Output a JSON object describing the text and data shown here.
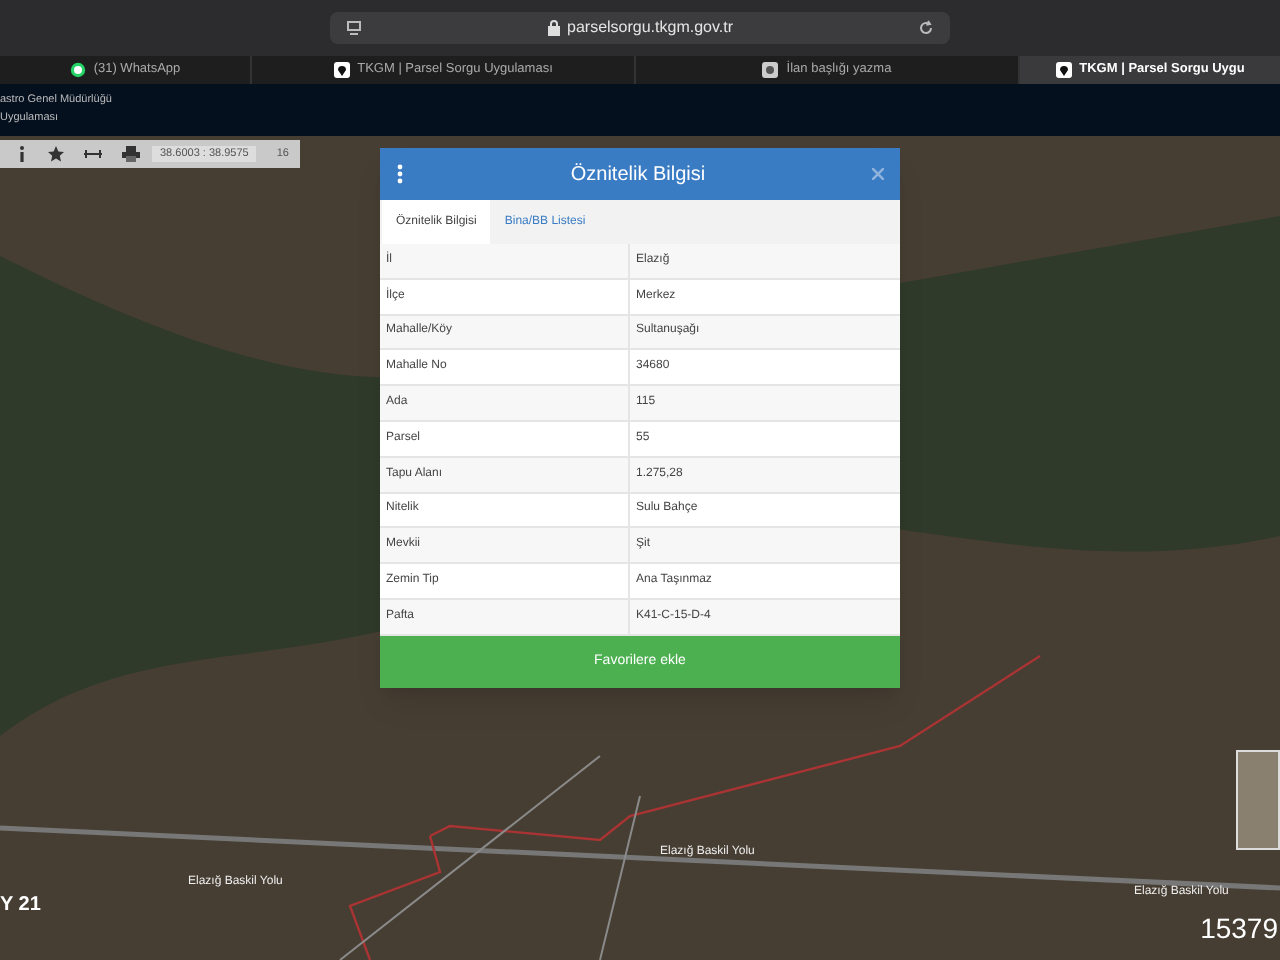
{
  "browser": {
    "url": "parselsorgu.tkgm.gov.tr"
  },
  "tabs": [
    {
      "label": "(31) WhatsApp",
      "kind": "chat",
      "selected": false
    },
    {
      "label": "TKGM | Parsel Sorgu Uygulaması",
      "kind": "pin",
      "selected": false
    },
    {
      "label": "İlan başlığı yazma",
      "kind": "camera",
      "selected": false
    },
    {
      "label": "TKGM | Parsel Sorgu Uygu",
      "kind": "pin",
      "selected": true
    }
  ],
  "header": {
    "line_1": "astro Genel Müdürlüğü",
    "line_2": "Uygulaması"
  },
  "toolbar": {
    "coordinates": "38.6003 : 38.9575",
    "zoom": "16"
  },
  "dialog": {
    "title": "Öznitelik Bilgisi",
    "tabs": [
      {
        "label": "Öznitelik Bilgisi",
        "selected": true
      },
      {
        "label": "Bina/BB Listesi",
        "selected": false
      }
    ],
    "rows": [
      {
        "label": "İl",
        "value": "Elazığ"
      },
      {
        "label": "İlçe",
        "value": "Merkez"
      },
      {
        "label": "Mahalle/Köy",
        "value": "Sultanuşağı"
      },
      {
        "label": "Mahalle No",
        "value": "34680"
      },
      {
        "label": "Ada",
        "value": "115"
      },
      {
        "label": "Parsel",
        "value": "55"
      },
      {
        "label": "Tapu Alanı",
        "value": "1.275,28"
      },
      {
        "label": "Nitelik",
        "value": "Sulu Bahçe"
      },
      {
        "label": "Mevkii",
        "value": "Şit"
      },
      {
        "label": "Zemin Tip",
        "value": "Ana Taşınmaz"
      },
      {
        "label": "Pafta",
        "value": "K41-C-15-D-4"
      }
    ],
    "button": "Favorilere ekle"
  },
  "map_labels": [
    "Elazığ Baskil Yolu",
    "Elazığ Baskil Yolu",
    "Elazığ Baskil Yolu",
    "Y 21"
  ],
  "corner_number": "15379"
}
